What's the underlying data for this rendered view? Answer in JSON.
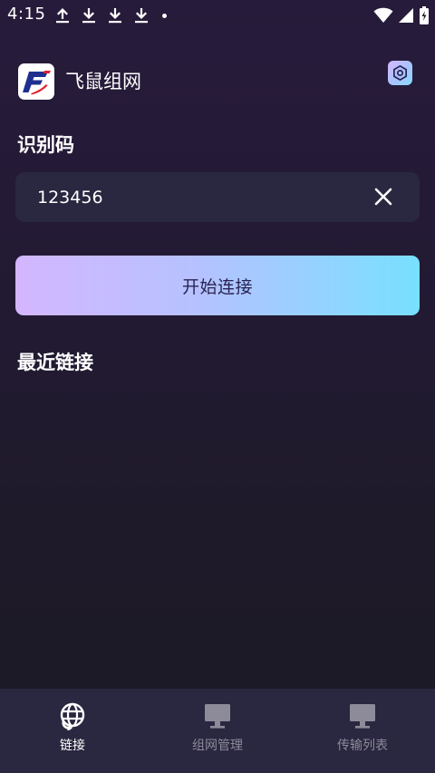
{
  "status_bar": {
    "time": "4:15",
    "left_icons": [
      "upload-icon",
      "download-icon",
      "download-icon",
      "download-icon",
      "notification-dot"
    ],
    "right_icons": [
      "wifi-icon",
      "signal-icon",
      "battery-charging-icon"
    ]
  },
  "header": {
    "logo_icon": "app-logo-f",
    "title": "飞鼠组网",
    "settings_icon": "settings-hex-icon"
  },
  "id_section": {
    "label": "识别码",
    "value": "123456",
    "clear_icon": "close-icon"
  },
  "connect_button": {
    "label": "开始连接"
  },
  "recent": {
    "label": "最近链接",
    "items": []
  },
  "bottom_nav": {
    "items": [
      {
        "label": "链接",
        "icon": "globe-link-icon",
        "active": true
      },
      {
        "label": "组网管理",
        "icon": "monitor-icon",
        "active": false
      },
      {
        "label": "传输列表",
        "icon": "monitor-icon",
        "active": false
      }
    ]
  },
  "colors": {
    "background_top": "#271b3b",
    "background_bottom": "#1c1a27",
    "input_background": "#2a2740",
    "nav_background": "#2a2740",
    "gradient_start": "#d4b6ff",
    "gradient_end": "#78e0ff",
    "button_text": "#2b2254",
    "nav_inactive": "#8d8a9a",
    "logo_blue": "#1f2f8f",
    "logo_red": "#e2202e"
  }
}
